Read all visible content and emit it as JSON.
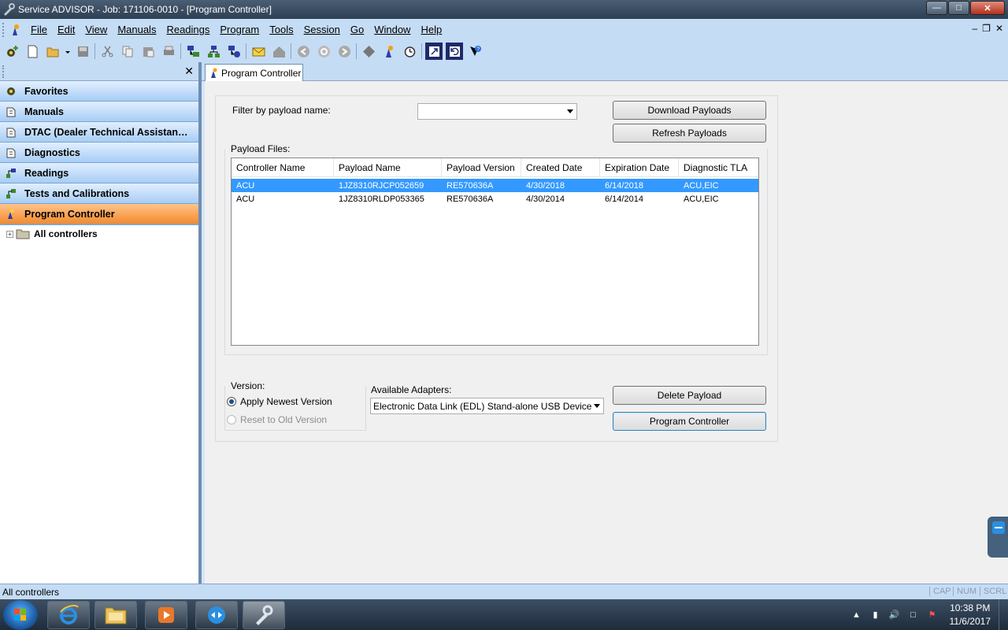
{
  "window": {
    "title": "Service ADVISOR - Job: 171106-0010 - [Program Controller]"
  },
  "menu": {
    "items": [
      "File",
      "Edit",
      "View",
      "Manuals",
      "Readings",
      "Program",
      "Tools",
      "Session",
      "Go",
      "Window",
      "Help"
    ]
  },
  "sidebar": {
    "items": [
      {
        "label": "Favorites",
        "icon": "gear-icon"
      },
      {
        "label": "Manuals",
        "icon": "book-icon"
      },
      {
        "label": "DTAC (Dealer Technical Assistance C...",
        "icon": "book-icon"
      },
      {
        "label": "Diagnostics",
        "icon": "book-icon"
      },
      {
        "label": "Readings",
        "icon": "readings-icon"
      },
      {
        "label": "Tests and Calibrations",
        "icon": "tests-icon"
      },
      {
        "label": "Program Controller",
        "icon": "program-controller-icon",
        "active": true
      }
    ],
    "tree_root": "All controllers"
  },
  "tab": {
    "label": "Program Controller"
  },
  "filter": {
    "label": "Filter by payload name:",
    "value": ""
  },
  "buttons": {
    "download": "Download Payloads",
    "refresh": "Refresh Payloads",
    "delete": "Delete Payload",
    "program": "Program Controller"
  },
  "payloads": {
    "label": "Payload Files:",
    "columns": [
      "Controller Name",
      "Payload Name",
      "Payload Version",
      "Created Date",
      "Expiration Date",
      "Diagnostic TLA"
    ],
    "rows": [
      [
        "ACU",
        "1JZ8310RJCP052659",
        "RE570636A",
        "4/30/2018",
        "6/14/2018",
        "ACU,EIC"
      ],
      [
        "ACU",
        "1JZ8310RLDP053365",
        "RE570636A",
        "4/30/2014",
        "6/14/2014",
        "ACU,EIC"
      ]
    ],
    "selected_row": 0
  },
  "version": {
    "label": "Version:",
    "options": [
      {
        "label": "Apply Newest Version",
        "checked": true,
        "enabled": true
      },
      {
        "label": "Reset to Old Version",
        "checked": false,
        "enabled": false
      }
    ]
  },
  "adapters": {
    "label": "Available Adapters:",
    "selected": "Electronic Data Link (EDL) Stand-alone USB Device"
  },
  "status": {
    "text": "All controllers",
    "cap": "CAP",
    "num": "NUM",
    "scrl": "SCRL"
  },
  "taskbar": {
    "time": "10:38 PM",
    "date": "11/6/2017"
  },
  "colors": {
    "nav_bar": "#c5dcf5",
    "active_nav": "#f48a2e",
    "selection": "#3399ff"
  }
}
